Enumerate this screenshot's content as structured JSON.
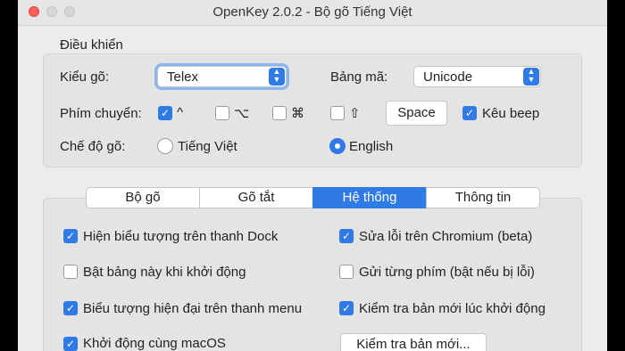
{
  "window": {
    "title": "OpenKey 2.0.2 - Bộ gõ Tiếng Việt"
  },
  "controls": {
    "section_label": "Điều khiển",
    "input_method_label": "Kiểu gõ:",
    "input_method_value": "Telex",
    "charset_label": "Bảng mã:",
    "charset_value": "Unicode",
    "hotkey_label": "Phím chuyển:",
    "hotkeys": [
      {
        "glyph": "^",
        "checked": true
      },
      {
        "glyph": "⌥",
        "checked": false
      },
      {
        "glyph": "⌘",
        "checked": false
      },
      {
        "glyph": "⇧",
        "checked": false
      }
    ],
    "hotkey_key": "Space",
    "beep_label": "Kêu beep",
    "beep_checked": true,
    "mode_label": "Chế độ gõ:",
    "mode_options": [
      {
        "label": "Tiếng Việt",
        "selected": false
      },
      {
        "label": "English",
        "selected": true
      }
    ]
  },
  "tabs": [
    {
      "label": "Bộ gõ",
      "active": false
    },
    {
      "label": "Gõ tắt",
      "active": false
    },
    {
      "label": "Hệ thống",
      "active": true
    },
    {
      "label": "Thông tin",
      "active": false
    }
  ],
  "system": {
    "options": [
      {
        "label": "Hiện biểu tượng trên thanh Dock",
        "checked": true
      },
      {
        "label": "Sửa lỗi trên Chromium (beta)",
        "checked": true
      },
      {
        "label": "Bật bảng này khi khởi động",
        "checked": false
      },
      {
        "label": "Gửi từng phím (bật nếu bị lỗi)",
        "checked": false
      },
      {
        "label": "Biểu tượng hiện đại trên thanh menu",
        "checked": true
      },
      {
        "label": "Kiểm tra bản mới lúc khởi động",
        "checked": true
      },
      {
        "label": "Khởi động cùng macOS",
        "checked": true
      }
    ],
    "check_update_button": "Kiểm tra bản mới..."
  }
}
